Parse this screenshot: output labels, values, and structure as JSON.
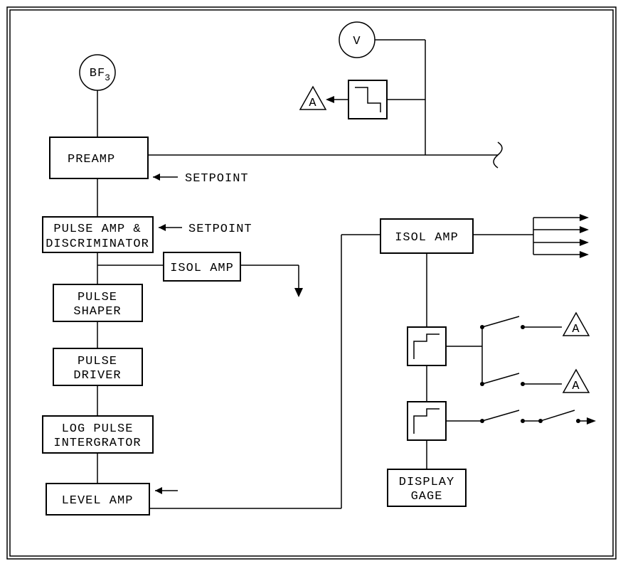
{
  "source_label": "BF",
  "source_sub": "3",
  "meter_label": "V",
  "alarm_label": "A",
  "blocks": {
    "preamp": "PREAMP",
    "pulse_amp_disc_1": "PULSE AMP &",
    "pulse_amp_disc_2": "DISCRIMINATOR",
    "isol_amp": "ISOL AMP",
    "pulse_shaper_1": "PULSE",
    "pulse_shaper_2": "SHAPER",
    "pulse_driver_1": "PULSE",
    "pulse_driver_2": "DRIVER",
    "log_pulse_int_1": "LOG PULSE",
    "log_pulse_int_2": "INTERGRATOR",
    "level_amp": "LEVEL AMP",
    "isol_amp_right": "ISOL AMP",
    "display_gage_1": "DISPLAY",
    "display_gage_2": "GAGE"
  },
  "setpoint_label": "SETPOINT"
}
